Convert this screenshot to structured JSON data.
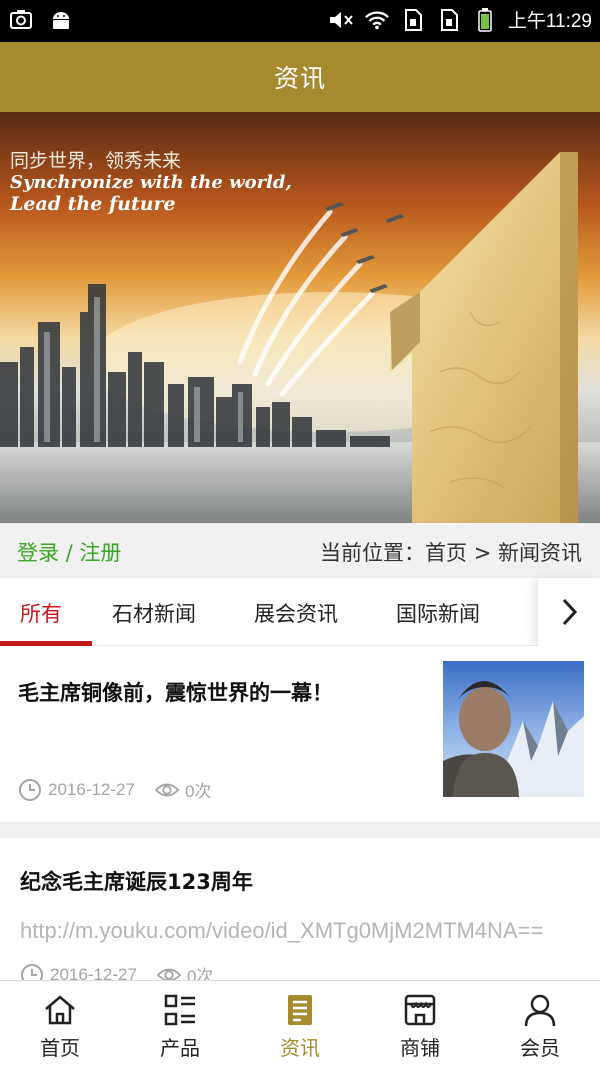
{
  "status_bar": {
    "time": "上午11:29",
    "left_icons": [
      "screenshot-icon",
      "android-icon"
    ],
    "right_icons": [
      "mute-icon",
      "wifi-icon",
      "sim1-icon",
      "sim2-icon",
      "battery-icon"
    ]
  },
  "header": {
    "title": "资讯"
  },
  "banner": {
    "slogan_cn": "同步世界，领秀未来",
    "slogan_en_line1": "Synchronize with the world,",
    "slogan_en_line2": "Lead the future"
  },
  "crumb_bar": {
    "login_register": "登录 / 注册",
    "location": "当前位置：首页 > 新闻资讯"
  },
  "tabs": [
    {
      "label": "所有",
      "active": true
    },
    {
      "label": "石材新闻",
      "active": false
    },
    {
      "label": "展会资讯",
      "active": false
    },
    {
      "label": "国际新闻",
      "active": false
    }
  ],
  "articles": [
    {
      "title": "毛主席铜像前，震惊世界的一幕！",
      "date": "2016-12-27",
      "views": "0次",
      "has_thumbnail": true
    },
    {
      "title": "纪念毛主席诞辰123周年",
      "url": "http://m.youku.com/video/id_XMTg0MjM2MTM4NA==",
      "date": "2016-12-27",
      "views": "0次",
      "has_thumbnail": false
    }
  ],
  "bottom_nav": [
    {
      "label": "首页",
      "icon": "home-icon",
      "active": false
    },
    {
      "label": "产品",
      "icon": "list-icon",
      "active": false
    },
    {
      "label": "资讯",
      "icon": "news-icon",
      "active": true
    },
    {
      "label": "商铺",
      "icon": "shop-icon",
      "active": false
    },
    {
      "label": "会员",
      "icon": "user-icon",
      "active": false
    }
  ],
  "colors": {
    "header_bg": "#a58a2e",
    "active_tab": "#c8161d",
    "login_link": "#3aa623",
    "active_nav": "#a58a2e"
  }
}
